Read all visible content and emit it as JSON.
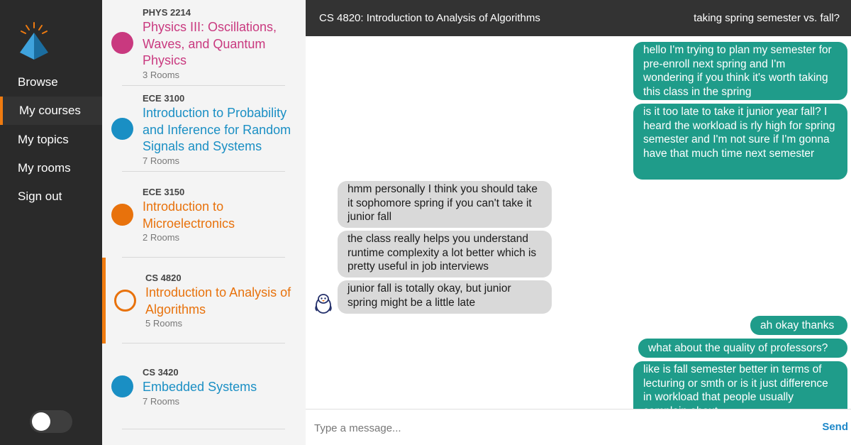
{
  "nav": {
    "items": [
      {
        "label": "Browse"
      },
      {
        "label": "My courses"
      },
      {
        "label": "My topics"
      },
      {
        "label": "My rooms"
      },
      {
        "label": "Sign out"
      }
    ],
    "active": "My courses",
    "logo_icon": "pyramid-logo-icon",
    "toggle_state": "off"
  },
  "courses": [
    {
      "code": "PHYS 2214",
      "title": "Physics III: Oscillations, Waves, and Quantum Physics",
      "rooms": "3 Rooms",
      "color": "#c9397f",
      "selected": false
    },
    {
      "code": "ECE 3100",
      "title": "Introduction to Probability and Inference for Random Signals and Systems",
      "rooms": "7 Rooms",
      "color": "#1a8fc4",
      "selected": false
    },
    {
      "code": "ECE 3150",
      "title": "Introduction to Microelectronics",
      "rooms": "2 Rooms",
      "color": "#e8720c",
      "selected": false
    },
    {
      "code": "CS 4820",
      "title": "Introduction to Analysis of Algorithms",
      "rooms": "5 Rooms",
      "color": "#e8720c",
      "selected": true
    },
    {
      "code": "CS 3420",
      "title": "Embedded Systems",
      "rooms": "7 Rooms",
      "color": "#1a8fc4",
      "selected": false
    }
  ],
  "chat": {
    "title": "CS 4820: Introduction to Analysis of Algorithms",
    "room": "taking spring semester vs. fall?",
    "messages": [
      {
        "from": "me",
        "text": "hello I'm trying to plan my semester for pre-enroll next spring and I'm wondering if you think it's worth taking this class in the spring"
      },
      {
        "from": "me",
        "text": "is it too late to take it junior year fall? I heard the workload is rly high for spring semester and I'm not sure if I'm gonna have that much time next semester"
      },
      {
        "from": "them",
        "text": "hmm personally I think you should take it sophomore spring if you can't take it junior fall"
      },
      {
        "from": "them",
        "text": "the class really helps you understand runtime complexity a lot better which is pretty useful in job interviews"
      },
      {
        "from": "them",
        "text": "junior fall is totally okay, but junior spring might be a little late"
      },
      {
        "from": "me",
        "text": "ah okay thanks"
      },
      {
        "from": "me",
        "text": "what about the quality of professors?"
      },
      {
        "from": "me",
        "text": "like is fall semester better in terms of lecturing or smth or is it just difference in workload that people usually complain about"
      }
    ],
    "avatar_icon": "penguin-avatar-icon",
    "input_placeholder": "Type a message...",
    "send_label": "Send"
  },
  "colors": {
    "accent": "#ef7b10",
    "my_bubble": "#1f9c8a",
    "their_bubble": "#d9d9d9",
    "link_blue": "#1e88c9"
  }
}
